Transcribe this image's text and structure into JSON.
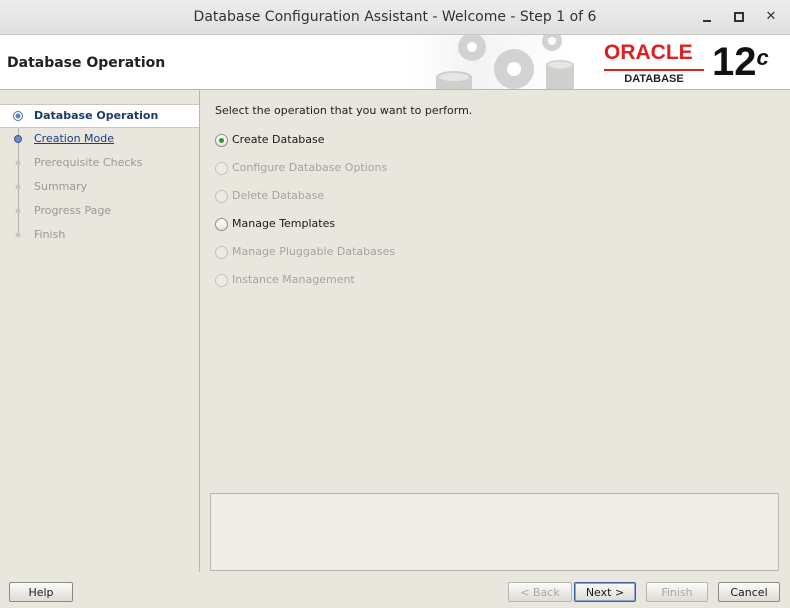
{
  "window": {
    "title": "Database Configuration Assistant - Welcome - Step 1 of 6"
  },
  "banner": {
    "heading": "Database Operation",
    "logo_word": "ORACLE",
    "logo_sub": "DATABASE",
    "version": "12",
    "version_suffix": "c"
  },
  "sidebar": {
    "steps": [
      {
        "label": "Database Operation",
        "state": "active"
      },
      {
        "label": "Creation Mode",
        "state": "link"
      },
      {
        "label": "Prerequisite Checks",
        "state": "disabled"
      },
      {
        "label": "Summary",
        "state": "disabled"
      },
      {
        "label": "Progress Page",
        "state": "disabled"
      },
      {
        "label": "Finish",
        "state": "disabled"
      }
    ]
  },
  "main": {
    "prompt": "Select the operation that you want to perform.",
    "options": [
      {
        "label": "Create Database",
        "selected": true,
        "enabled": true
      },
      {
        "label": "Configure Database Options",
        "selected": false,
        "enabled": false
      },
      {
        "label": "Delete Database",
        "selected": false,
        "enabled": false
      },
      {
        "label": "Manage Templates",
        "selected": false,
        "enabled": true
      },
      {
        "label": "Manage Pluggable Databases",
        "selected": false,
        "enabled": false
      },
      {
        "label": "Instance Management",
        "selected": false,
        "enabled": false
      }
    ]
  },
  "buttons": {
    "help": "Help",
    "back": "< Back",
    "next": "Next >",
    "finish": "Finish",
    "cancel": "Cancel"
  },
  "colors": {
    "oracle_red": "#e02020",
    "panel_bg": "#e8e6dd",
    "active_step_text": "#1c3a6a",
    "selected_radio": "#3a8a3a"
  }
}
